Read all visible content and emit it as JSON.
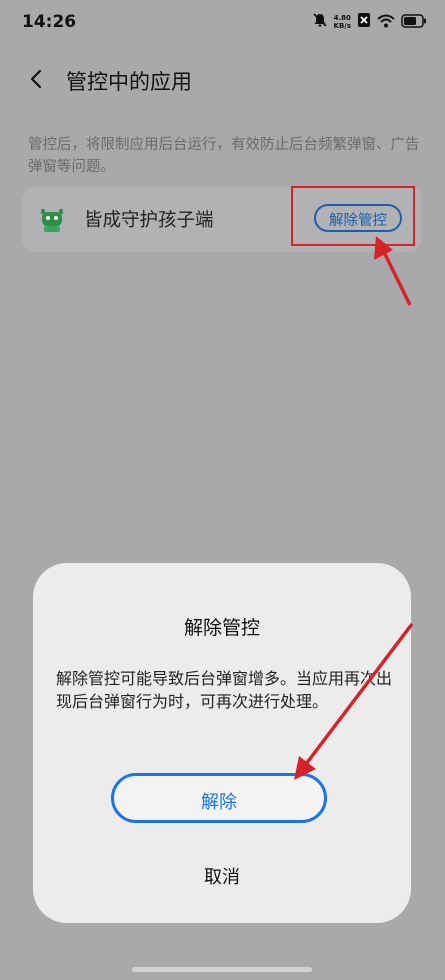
{
  "status_bar": {
    "time": "14:26",
    "net_speed_value": "4.80",
    "net_speed_unit": "KB/s",
    "icons": [
      "bell-muted-icon",
      "sim-off-icon",
      "wifi-icon",
      "battery-icon"
    ]
  },
  "nav": {
    "title": "管控中的应用",
    "back_icon": "chevron-left-icon"
  },
  "description": "管控后，将限制应用后台运行，有效防止后台频繁弹窗、广告弹窗等问题。",
  "app_list": [
    {
      "name": "皆成守护孩子端",
      "icon": "app-robot-icon",
      "action_label": "解除管控"
    }
  ],
  "dialog": {
    "title": "解除管控",
    "message": "解除管控可能导致后台弹窗增多。当应用再次出现后台弹窗行为时，可再次进行处理。",
    "confirm_label": "解除",
    "cancel_label": "取消"
  },
  "colors": {
    "accent": "#1b73e8",
    "annotation": "#d6232a",
    "overlay_bg": "#a9a9ab"
  }
}
